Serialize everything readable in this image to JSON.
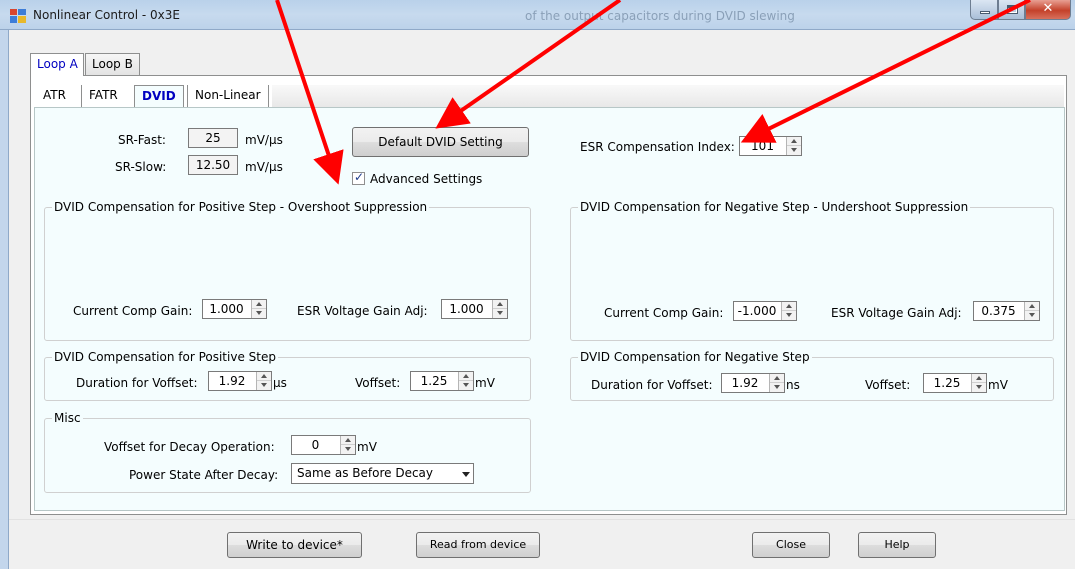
{
  "window": {
    "title": "Nonlinear Control - 0x3E",
    "background_title_text": "of the output capacitors during DVID slewing"
  },
  "outer_tabs": [
    {
      "label": "Loop A",
      "active": true
    },
    {
      "label": "Loop B",
      "active": false
    }
  ],
  "inner_tabs": [
    {
      "label": "ATR",
      "active": false
    },
    {
      "label": "FATR",
      "active": false
    },
    {
      "label": "DVID",
      "active": true
    },
    {
      "label": "Non-Linear",
      "active": false
    }
  ],
  "slew": {
    "fast_label": "SR-Fast:",
    "fast_value": "25",
    "fast_unit": "mV/µs",
    "slow_label": "SR-Slow:",
    "slow_value": "12.50",
    "slow_unit": "mV/µs"
  },
  "default_button": "Default DVID Setting",
  "advanced": {
    "label": "Advanced Settings",
    "checked": true
  },
  "esr_index": {
    "label": "ESR Compensation Index:",
    "value": "101"
  },
  "pos_overshoot": {
    "title": "DVID Compensation for Positive Step - Overshoot Suppression",
    "current_gain_label": "Current Comp Gain:",
    "current_gain_value": "1.000",
    "esr_gain_label": "ESR Voltage Gain Adj:",
    "esr_gain_value": "1.000"
  },
  "neg_undershoot": {
    "title": "DVID Compensation for Negative Step - Undershoot Suppression",
    "current_gain_label": "Current Comp Gain:",
    "current_gain_value": "-1.000",
    "esr_gain_label": "ESR Voltage Gain Adj:",
    "esr_gain_value": "0.375"
  },
  "pos_step": {
    "title": "DVID Compensation for Positive Step",
    "duration_label": "Duration for Voffset:",
    "duration_value": "1.92",
    "duration_unit": "µs",
    "voffset_label": "Voffset:",
    "voffset_value": "1.25",
    "voffset_unit": "mV"
  },
  "neg_step": {
    "title": "DVID Compensation for Negative Step",
    "duration_label": "Duration for Voffset:",
    "duration_value": "1.92",
    "duration_unit": "ns",
    "voffset_label": "Voffset:",
    "voffset_value": "1.25",
    "voffset_unit": "mV"
  },
  "misc": {
    "title": "Misc",
    "decay_label": "Voffset for Decay Operation:",
    "decay_value": "0",
    "decay_unit": "mV",
    "power_label": "Power State After Decay:",
    "power_value": "Same as Before Decay"
  },
  "bottom_buttons": {
    "write": "Write to device*",
    "read": "Read from device",
    "close": "Close",
    "help": "Help"
  },
  "colors": {
    "annotation_arrow": "#ff0000",
    "active_tab_text": "#0000c0",
    "panel_background": "#f4fdfe"
  }
}
